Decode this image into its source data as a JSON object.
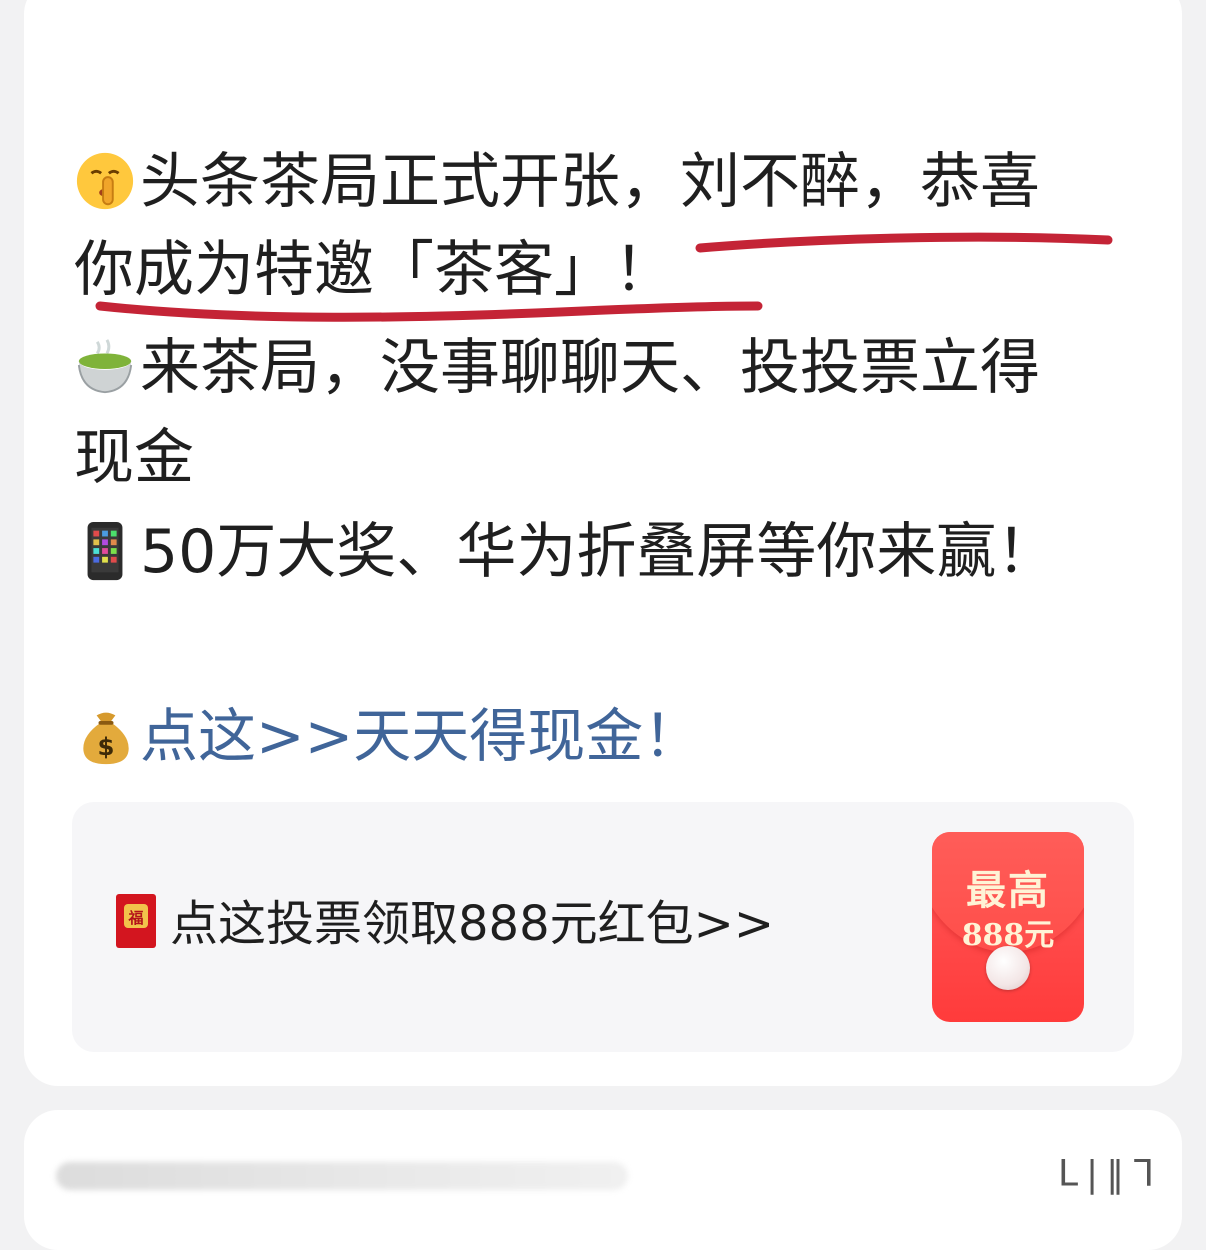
{
  "post": {
    "line1": "头条茶局正式开张，刘不醉，恭喜",
    "line2": "你成为特邀「茶客」！",
    "line3": "来茶局，没事聊聊天、投投票立得",
    "line4": "现金",
    "line5": "50万大奖、华为折叠屏等你来赢！",
    "link": "点这>>天天得现金！",
    "icons": [
      "shushing-face-icon",
      "tea-cup-icon",
      "mobile-phone-icon",
      "money-bag-icon"
    ],
    "underline_color": "#c42436",
    "link_color": "#406599"
  },
  "promo": {
    "text": "点这投票领取888元红包>>",
    "icon": "red-envelope-icon",
    "packet_title": "最高",
    "packet_amount": "888元",
    "packet_color": "#ff3b3b"
  },
  "next_card": {
    "corner": "ᒪ|‖ᒣ"
  }
}
